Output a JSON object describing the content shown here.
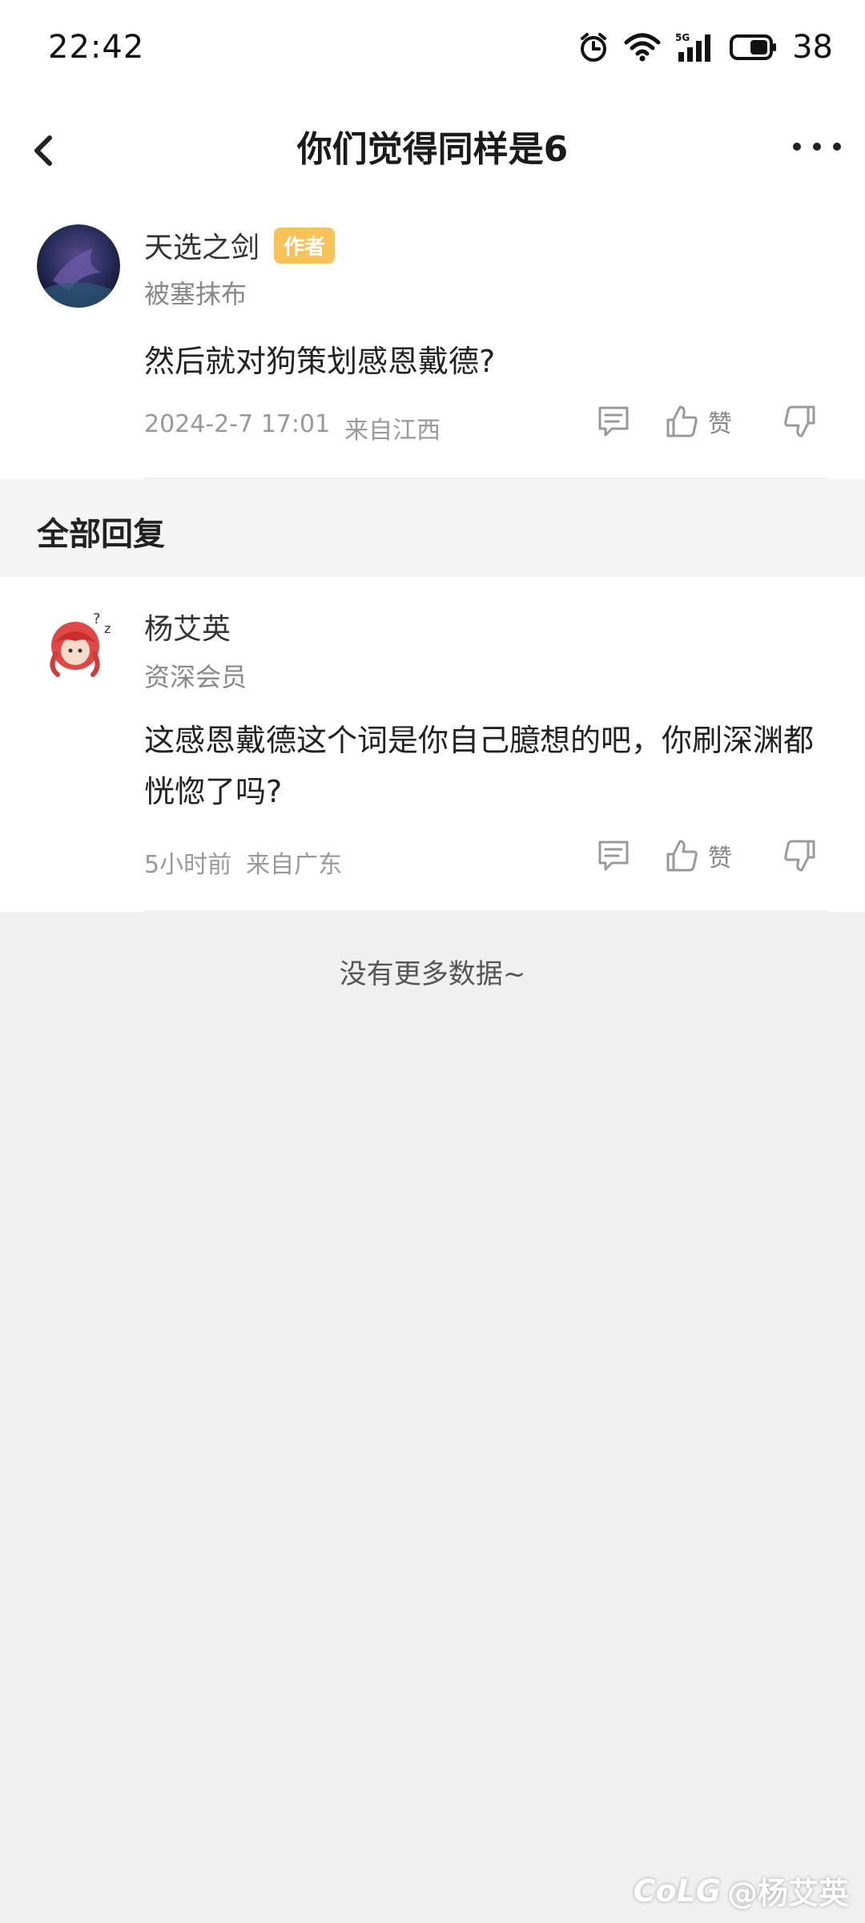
{
  "status_bar": {
    "time": "22:42",
    "battery": "38",
    "network": "5G",
    "icons": [
      "alarm-icon",
      "wifi-icon",
      "signal-5g-icon",
      "battery-icon"
    ]
  },
  "nav": {
    "title": "你们觉得同样是6",
    "back_icon": "back-chevron-icon",
    "more_icon": "more-dots-icon"
  },
  "post": {
    "author": "天选之剑",
    "badge": "作者",
    "subtitle": "被塞抹布",
    "content": "然后就对狗策划感恩戴德?",
    "date": "2024-2-7 17:01",
    "location": "来自江西",
    "like_label": "赞"
  },
  "section": {
    "title": "全部回复"
  },
  "reply": {
    "author": "杨艾英",
    "subtitle": "资深会员",
    "content": "这感恩戴德这个词是你自己臆想的吧，你刷深渊都恍惚了吗?",
    "time": "5小时前",
    "location": "来自广东",
    "like_label": "赞"
  },
  "footer": {
    "no_more": "没有更多数据~"
  },
  "watermark": {
    "logo": "CoLG",
    "user": "@杨艾英"
  },
  "colors": {
    "badge": "#f8c25a",
    "background": "#f0f0f0",
    "card": "#ffffff"
  }
}
